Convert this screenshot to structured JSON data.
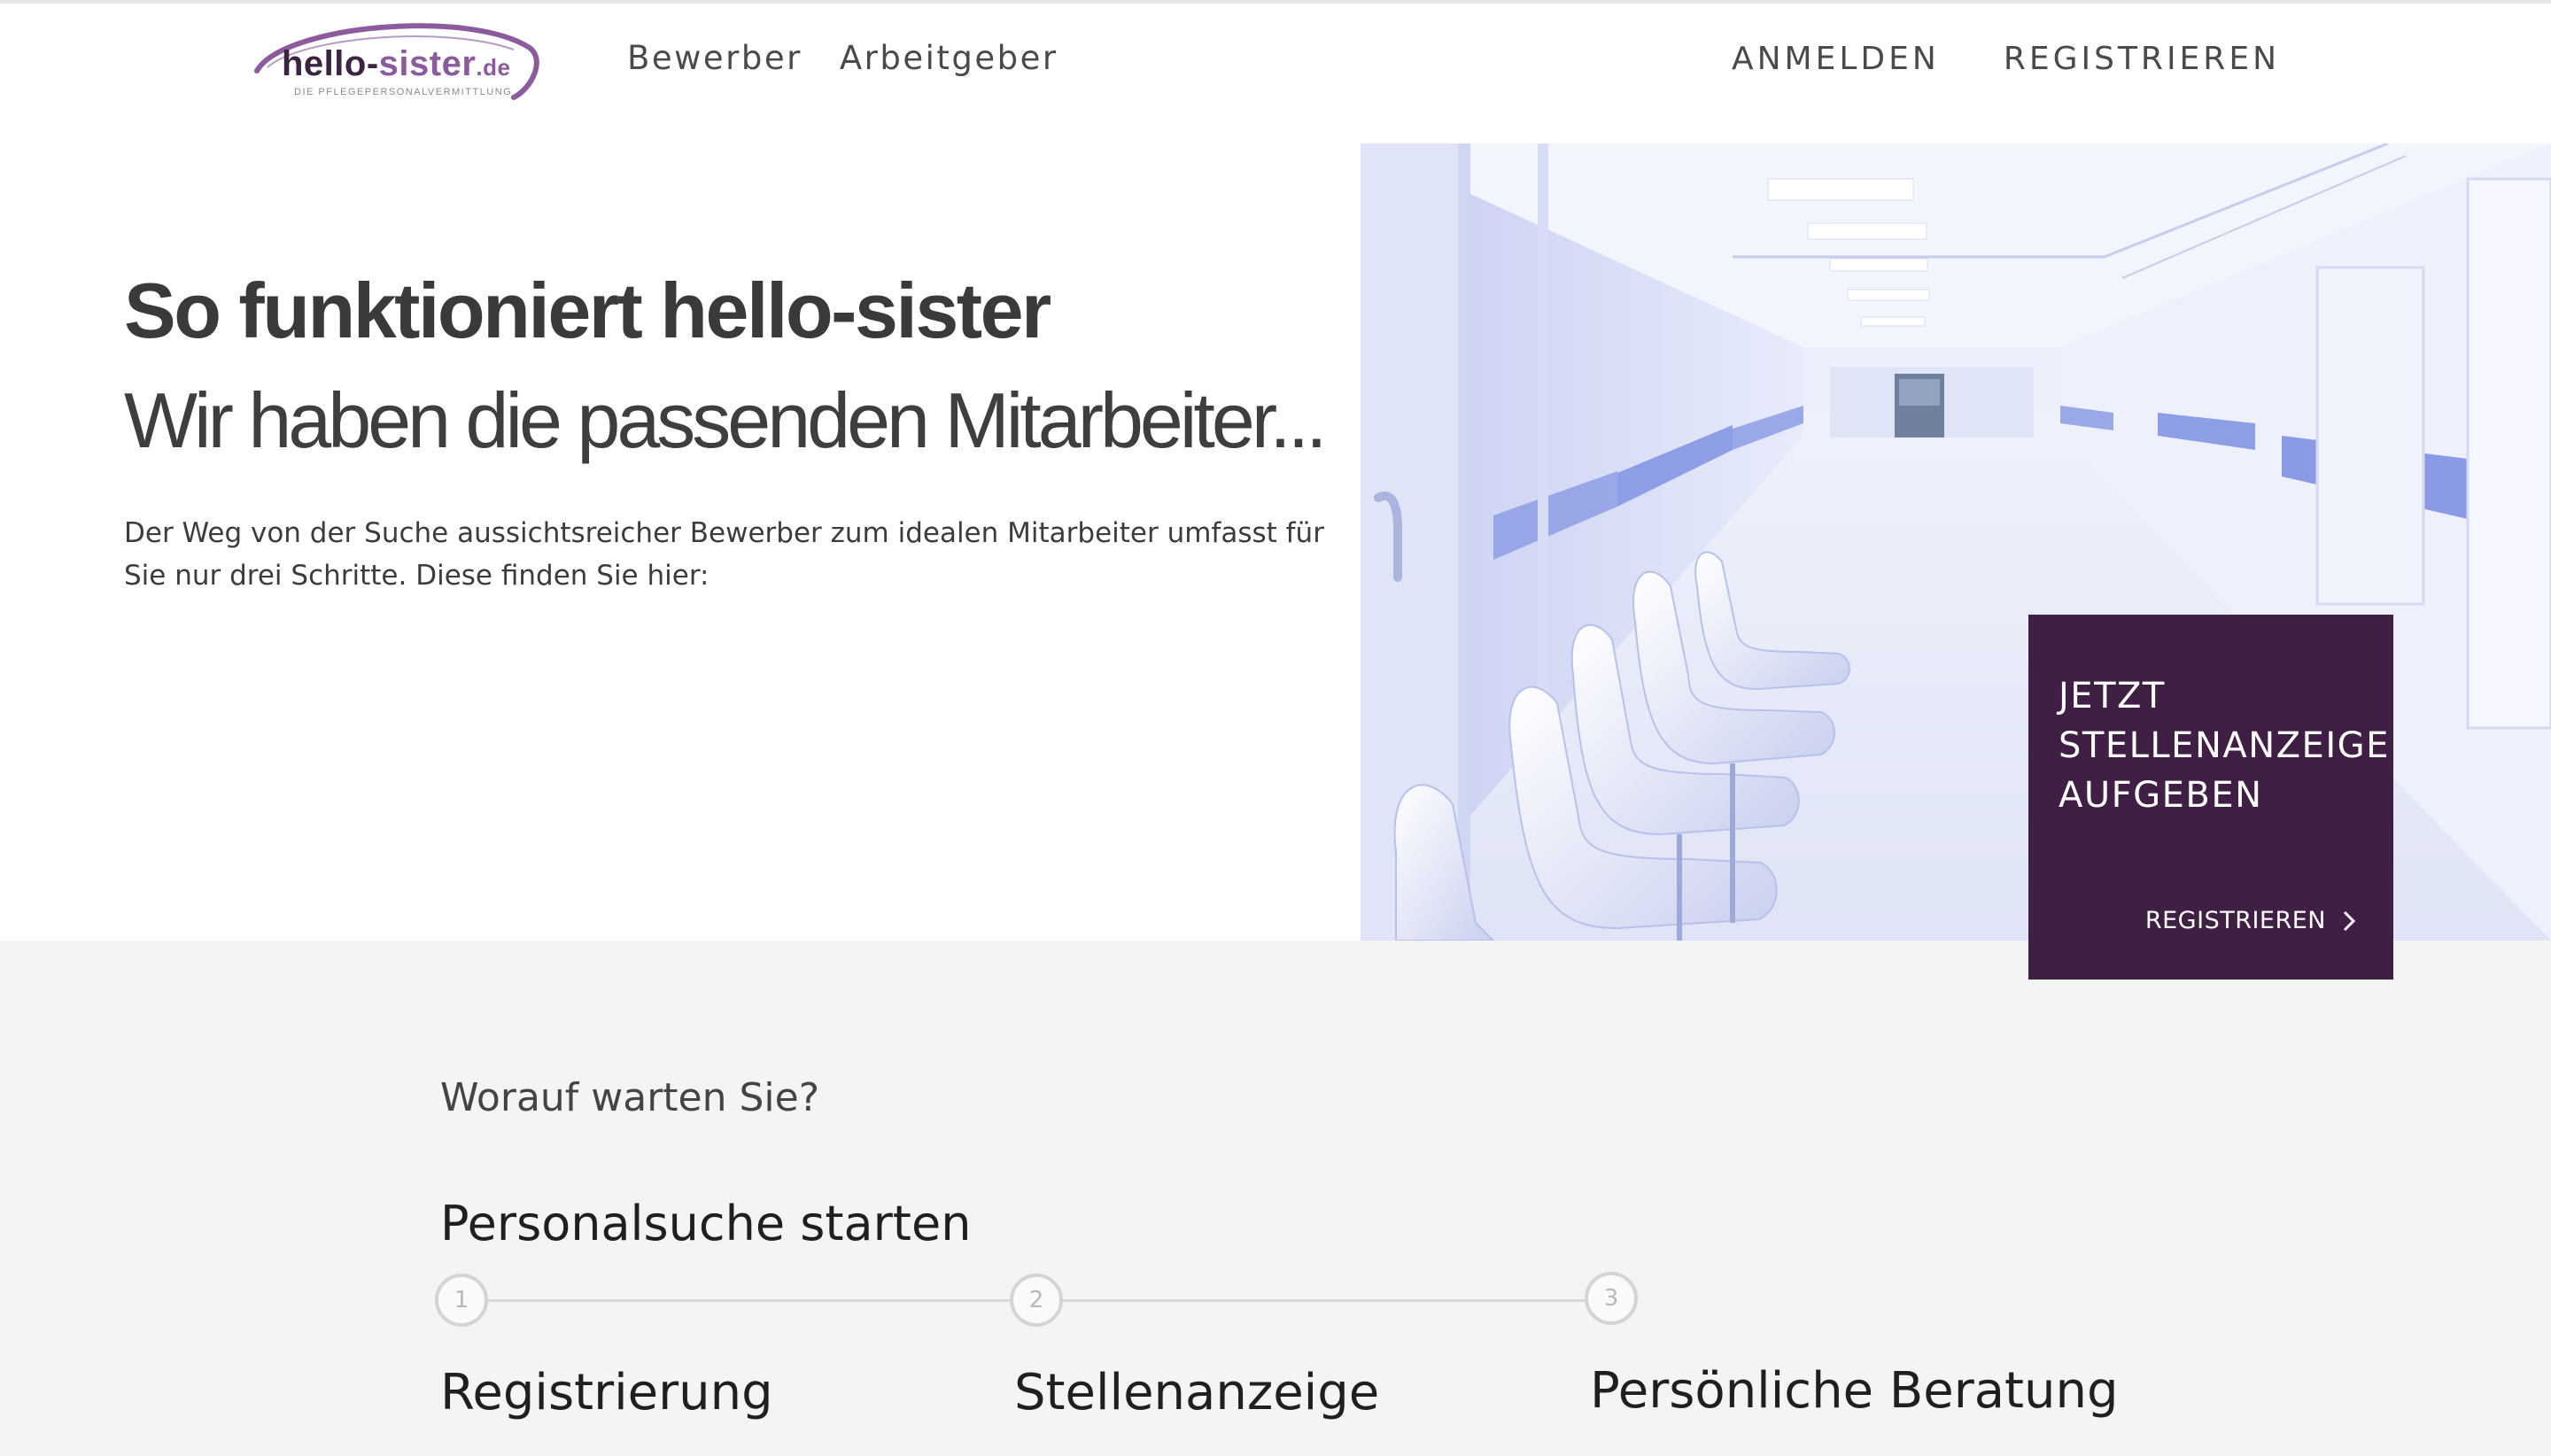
{
  "brand": {
    "name_part1": "hello-",
    "name_part2": "sister",
    "tld": ".de",
    "tagline": "DIE PFLEGEPERSONALVERMITTLUNG",
    "color_primary": "#3f1f43",
    "color_accent": "#8c5b9e"
  },
  "nav": {
    "main": [
      {
        "label": "Bewerber"
      },
      {
        "label": "Arbeitgeber"
      }
    ],
    "right": [
      {
        "label": "ANMELDEN"
      },
      {
        "label": "REGISTRIEREN"
      }
    ]
  },
  "hero": {
    "title": "So funktioniert hello-sister",
    "subtitle": "Wir haben die passenden Mitarbeiter...",
    "description": "Der Weg von der Suche aussichtsreicher Bewerber zum idealen Mitarbeiter umfasst für Sie nur drei Schritte. Diese finden Sie hier:",
    "image": "hospital-corridor-with-waiting-chairs"
  },
  "cta": {
    "title": "JETZT STELLENANZEIGE AUFGEBEN",
    "link_label": "REGISTRIEREN",
    "link_icon": "chevron-right-icon"
  },
  "steps_section": {
    "kicker": "Worauf warten Sie?",
    "title": "Personalsuche starten",
    "steps": [
      {
        "number": "1",
        "label": "Registrierung"
      },
      {
        "number": "2",
        "label": "Stellenanzeige"
      },
      {
        "number": "3",
        "label": "Persönliche Beratung"
      }
    ]
  }
}
